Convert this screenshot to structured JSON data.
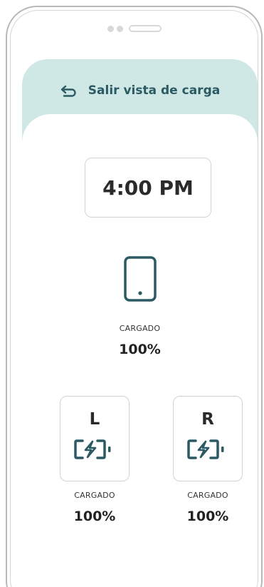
{
  "header": {
    "exit_label": "Salir vista de carga",
    "background_color": "#cfe8e6",
    "accent_color": "#2c5a63"
  },
  "time": {
    "value": "4:00 PM"
  },
  "phone_status": {
    "icon": "smartphone-icon",
    "label": "CARGADO",
    "value": "100%"
  },
  "earbuds": {
    "left": {
      "letter": "L",
      "icon": "battery-charging-icon",
      "label": "CARGADO",
      "value": "100%"
    },
    "right": {
      "letter": "R",
      "icon": "battery-charging-icon",
      "label": "CARGADO",
      "value": "100%"
    }
  }
}
